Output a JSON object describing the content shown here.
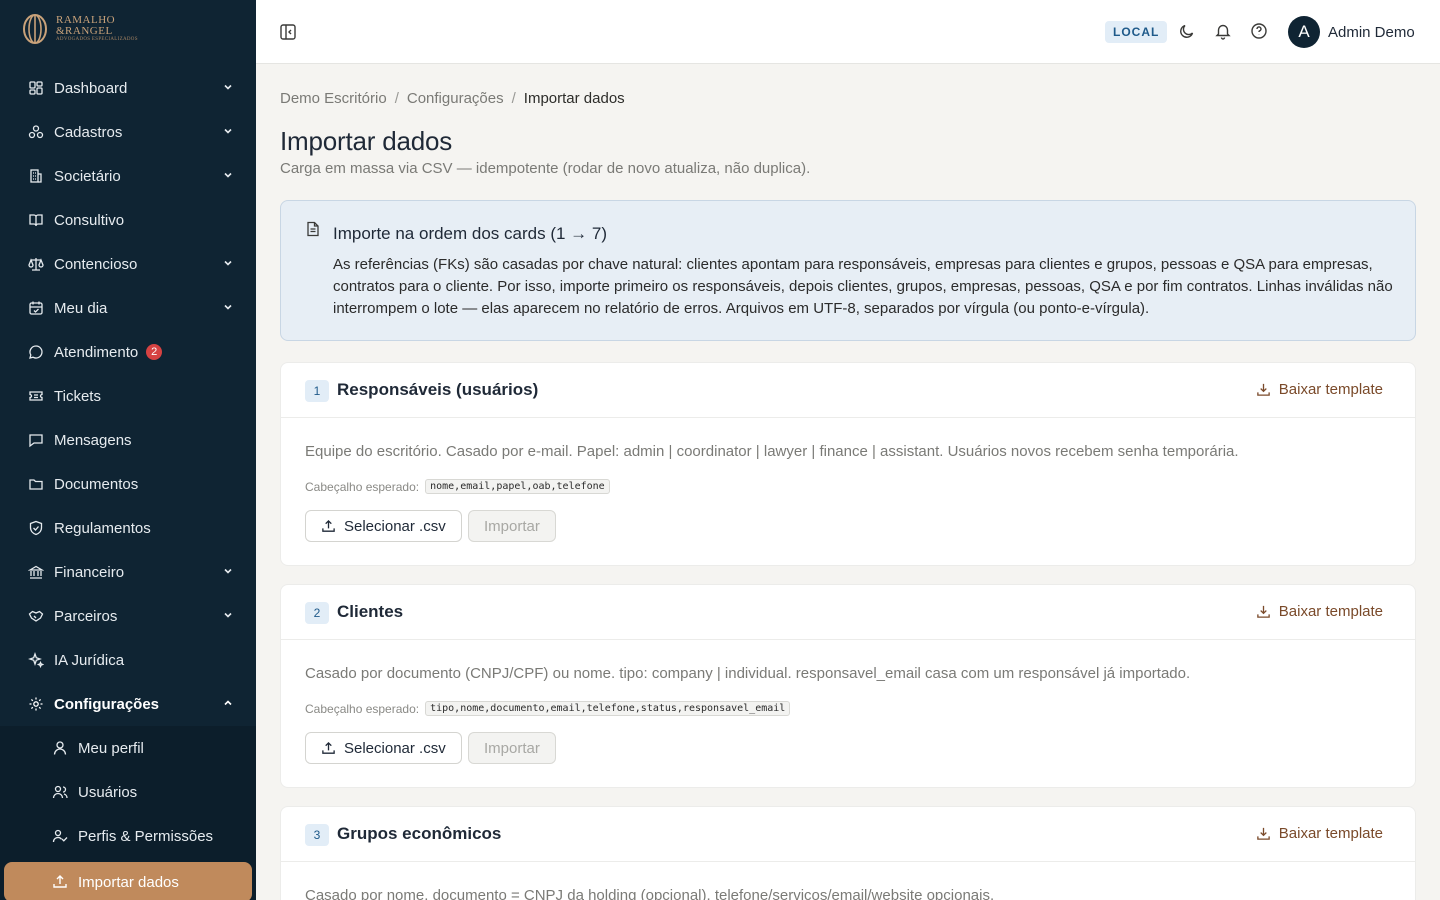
{
  "brand": {
    "line1": "RAMALHO",
    "line2": "&RANGEL",
    "tagline": "ADVOGADOS ESPECIALIZADOS",
    "color": "#c9a27a"
  },
  "sidebar": {
    "items": [
      {
        "label": "Dashboard",
        "icon": "dashboard-icon",
        "expandable": true
      },
      {
        "label": "Cadastros",
        "icon": "cadastros-icon",
        "expandable": true
      },
      {
        "label": "Societário",
        "icon": "building-icon",
        "expandable": true
      },
      {
        "label": "Consultivo",
        "icon": "book-icon",
        "expandable": false
      },
      {
        "label": "Contencioso",
        "icon": "scale-icon",
        "expandable": true
      },
      {
        "label": "Meu dia",
        "icon": "calendar-icon",
        "expandable": true
      },
      {
        "label": "Atendimento",
        "icon": "chat-icon",
        "expandable": false,
        "badge": "2"
      },
      {
        "label": "Tickets",
        "icon": "ticket-icon",
        "expandable": false
      },
      {
        "label": "Mensagens",
        "icon": "message-icon",
        "expandable": false
      },
      {
        "label": "Documentos",
        "icon": "folder-icon",
        "expandable": false
      },
      {
        "label": "Regulamentos",
        "icon": "shield-icon",
        "expandable": false
      },
      {
        "label": "Financeiro",
        "icon": "bank-icon",
        "expandable": true
      },
      {
        "label": "Parceiros",
        "icon": "handshake-icon",
        "expandable": true
      },
      {
        "label": "IA Jurídica",
        "icon": "sparkles-icon",
        "expandable": false
      },
      {
        "label": "Configurações",
        "icon": "gear-icon",
        "expandable": true,
        "expanded": true
      }
    ],
    "subitems": [
      {
        "label": "Meu perfil",
        "icon": "user-icon"
      },
      {
        "label": "Usuários",
        "icon": "users-icon"
      },
      {
        "label": "Perfis & Permissões",
        "icon": "user-check-icon"
      },
      {
        "label": "Importar dados",
        "icon": "upload-icon",
        "current": true
      }
    ]
  },
  "topbar": {
    "env": "LOCAL",
    "user_initial": "A",
    "user_name": "Admin Demo"
  },
  "breadcrumb": [
    "Demo Escritório",
    "Configurações",
    "Importar dados"
  ],
  "page": {
    "title": "Importar dados",
    "subtitle": "Carga em massa via CSV — idempotente (rodar de novo atualiza, não duplica)."
  },
  "info": {
    "title": "Importe na ordem dos cards (1 → 7)",
    "text": "As referências (FKs) são casadas por chave natural: clientes apontam para responsáveis, empresas para clientes e grupos, pessoas e QSA para empresas, contratos para o cliente. Por isso, importe primeiro os responsáveis, depois clientes, grupos, empresas, pessoas, QSA e por fim contratos. Linhas inválidas não interrompem o lote — elas aparecem no relatório de erros. Arquivos em UTF-8, separados por vírgula (ou ponto-e-vírgula)."
  },
  "cards": [
    {
      "step": "1",
      "title": "Responsáveis (usuários)",
      "download_label": "Baixar template",
      "description": "Equipe do escritório. Casado por e-mail. Papel: admin | coordinator | lawyer | finance | assistant. Usuários novos recebem senha temporária.",
      "header_label": "Cabeçalho esperado:",
      "header_code": "nome,email,papel,oab,telefone",
      "select_label": "Selecionar .csv",
      "import_label": "Importar"
    },
    {
      "step": "2",
      "title": "Clientes",
      "download_label": "Baixar template",
      "description": "Casado por documento (CNPJ/CPF) ou nome. tipo: company | individual. responsavel_email casa com um responsável já importado.",
      "header_label": "Cabeçalho esperado:",
      "header_code": "tipo,nome,documento,email,telefone,status,responsavel_email",
      "select_label": "Selecionar .csv",
      "import_label": "Importar"
    },
    {
      "step": "3",
      "title": "Grupos econômicos",
      "download_label": "Baixar template",
      "description": "Casado por nome. documento = CNPJ da holding (opcional). telefone/servicos/email/website opcionais.",
      "header_label": "",
      "header_code": "",
      "select_label": "",
      "import_label": ""
    }
  ],
  "colors": {
    "sidebar_bg": "#0f2433",
    "accent": "#c08a5c",
    "badge": "#d64242",
    "info_bg": "#e7eef5"
  }
}
